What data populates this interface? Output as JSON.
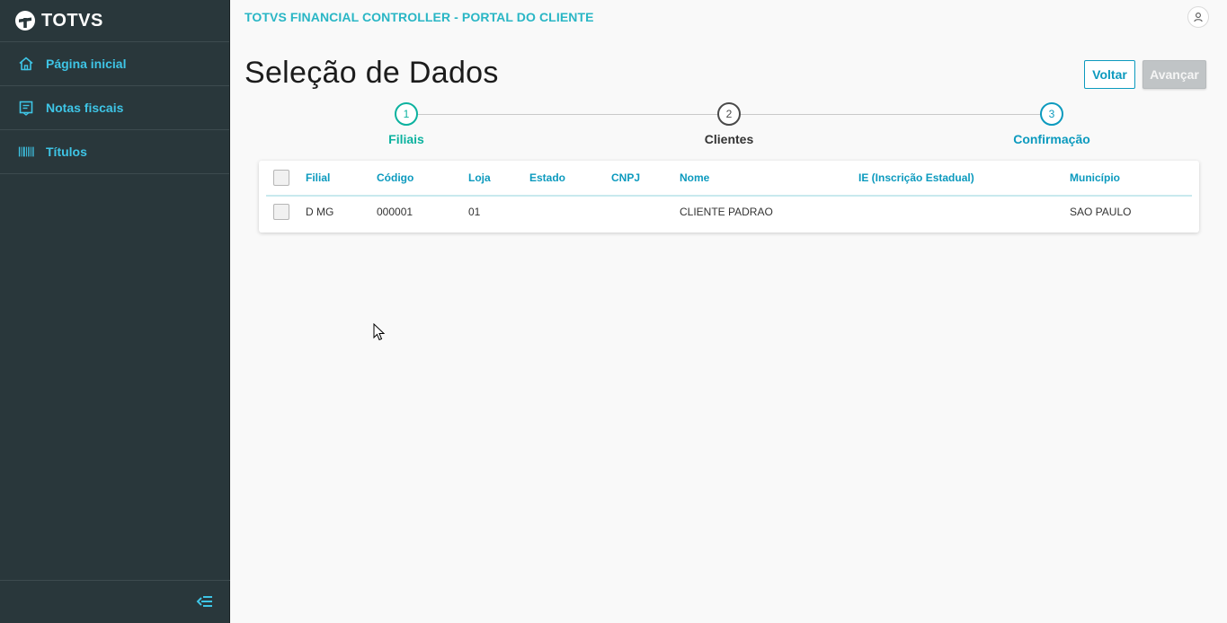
{
  "brand": {
    "name": "TOTVS"
  },
  "sidebar": {
    "items": [
      {
        "label": "Página inicial",
        "icon": "home-icon"
      },
      {
        "label": "Notas fiscais",
        "icon": "invoice-icon"
      },
      {
        "label": "Títulos",
        "icon": "barcode-icon"
      }
    ]
  },
  "header": {
    "app_title": "TOTVS FINANCIAL CONTROLLER - PORTAL DO CLIENTE"
  },
  "page": {
    "title": "Seleção de Dados",
    "back_label": "Voltar",
    "next_label": "Avançar"
  },
  "stepper": {
    "steps": [
      {
        "number": "1",
        "label": "Filiais",
        "state": "done"
      },
      {
        "number": "2",
        "label": "Clientes",
        "state": "current"
      },
      {
        "number": "3",
        "label": "Confirmação",
        "state": "upcoming"
      }
    ]
  },
  "table": {
    "columns": [
      "Filial",
      "Código",
      "Loja",
      "Estado",
      "CNPJ",
      "Nome",
      "IE (Inscrição Estadual)",
      "Município"
    ],
    "rows": [
      [
        "D MG",
        "000001",
        "01",
        "",
        "",
        "CLIENTE PADRAO",
        "",
        "SAO PAULO"
      ]
    ]
  },
  "colors": {
    "sidebar_bg": "#29373b",
    "menu_text": "#3ec5e6",
    "primary": "#0c9abe",
    "success": "#0cb29f"
  }
}
